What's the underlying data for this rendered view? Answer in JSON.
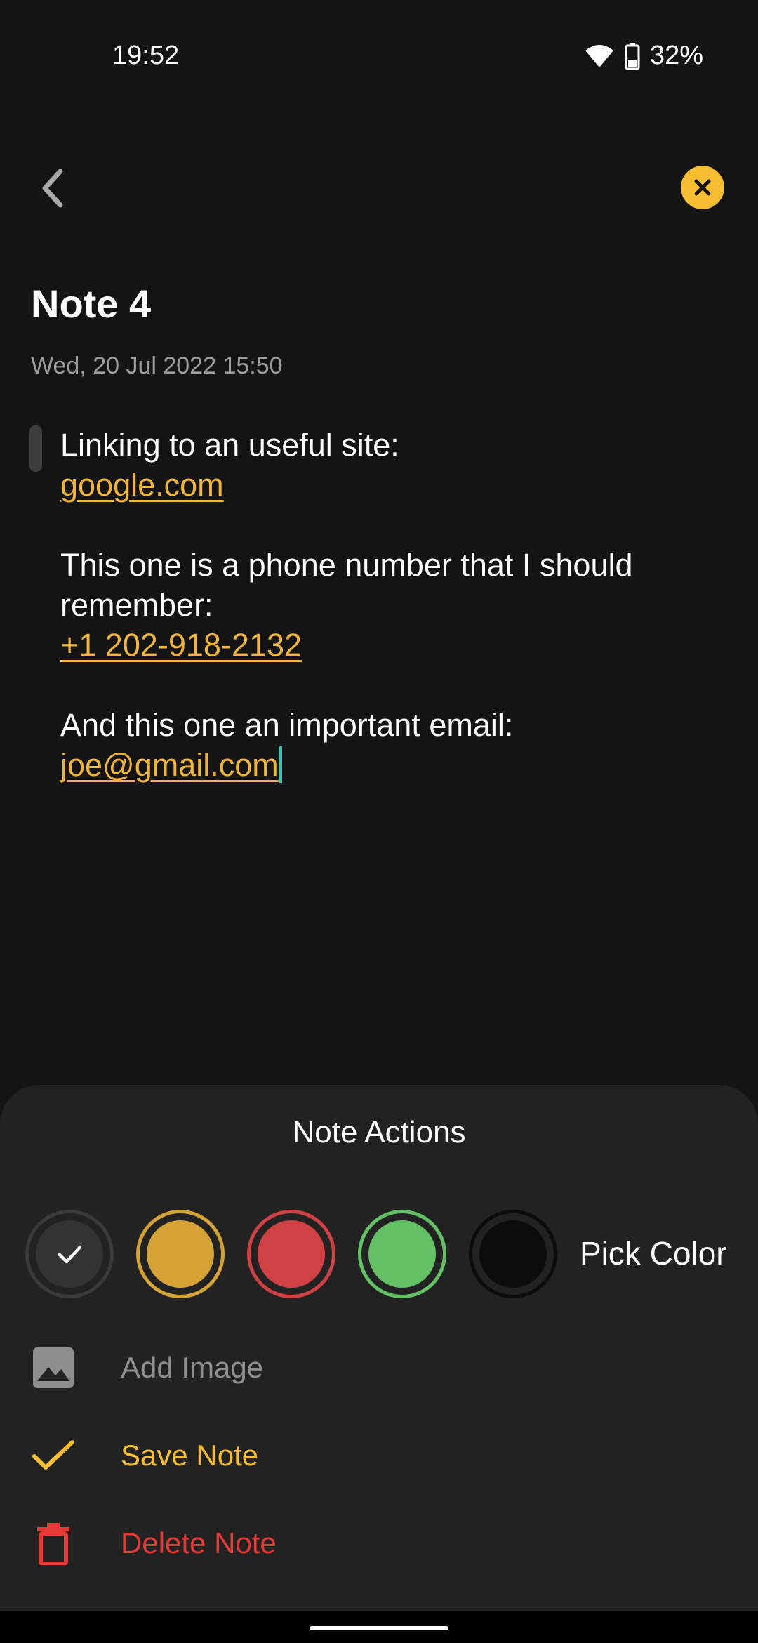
{
  "status_bar": {
    "time": "19:52",
    "battery": "32%"
  },
  "header": {
    "back_icon": "chevron-left-icon",
    "close_icon": "close-circle-icon"
  },
  "note": {
    "title": "Note 4",
    "date": "Wed, 20 Jul 2022 15:50",
    "lines": {
      "l1": "Linking to an useful site:",
      "link1": "google.com",
      "l2a": "This one is a phone number that I should",
      "l2b": "remember:",
      "link2": "+1 202-918-2132",
      "l3": "And this one an important email:",
      "link3": "joe@gmail.com"
    }
  },
  "actions_sheet": {
    "title": "Note Actions",
    "colors": [
      {
        "name": "default",
        "hex": "#333333",
        "selected": true
      },
      {
        "name": "yellow",
        "hex": "#d4a235",
        "selected": false
      },
      {
        "name": "red",
        "hex": "#cf4143",
        "selected": false
      },
      {
        "name": "green",
        "hex": "#63c065",
        "selected": false
      },
      {
        "name": "black",
        "hex": "#0c0c0c",
        "selected": false
      }
    ],
    "pick_color_label": "Pick Color",
    "add_image_label": "Add Image",
    "save_note_label": "Save Note",
    "delete_note_label": "Delete Note"
  },
  "theme": {
    "accent": "#f9bd32",
    "link": "#f0b53a",
    "danger": "#e53935",
    "background": "#141414",
    "sheet": "#222222"
  }
}
